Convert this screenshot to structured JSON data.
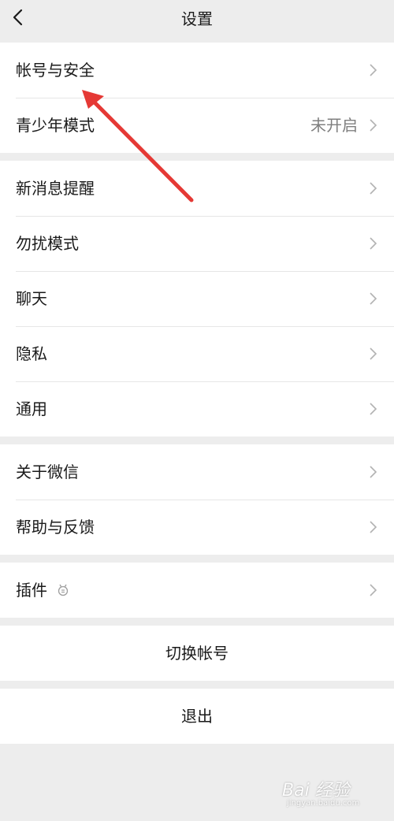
{
  "header": {
    "title": "设置"
  },
  "groups": [
    {
      "rows": [
        {
          "label": "帐号与安全",
          "value": ""
        },
        {
          "label": "青少年模式",
          "value": "未开启"
        }
      ]
    },
    {
      "rows": [
        {
          "label": "新消息提醒",
          "value": ""
        },
        {
          "label": "勿扰模式",
          "value": ""
        },
        {
          "label": "聊天",
          "value": ""
        },
        {
          "label": "隐私",
          "value": ""
        },
        {
          "label": "通用",
          "value": ""
        }
      ]
    },
    {
      "rows": [
        {
          "label": "关于微信",
          "value": ""
        },
        {
          "label": "帮助与反馈",
          "value": ""
        }
      ]
    },
    {
      "rows": [
        {
          "label": "插件",
          "value": ""
        }
      ]
    }
  ],
  "actions": {
    "switch_account": "切换帐号",
    "logout": "退出"
  },
  "annotation": {
    "arrow_color": "#e53935"
  },
  "watermark": {
    "text": "Bai 经验",
    "sub": "jingyan.baidu.com"
  },
  "icons": {
    "back": "back-icon",
    "chevron": "chevron-right-icon",
    "plugin": "plugin-icon"
  }
}
